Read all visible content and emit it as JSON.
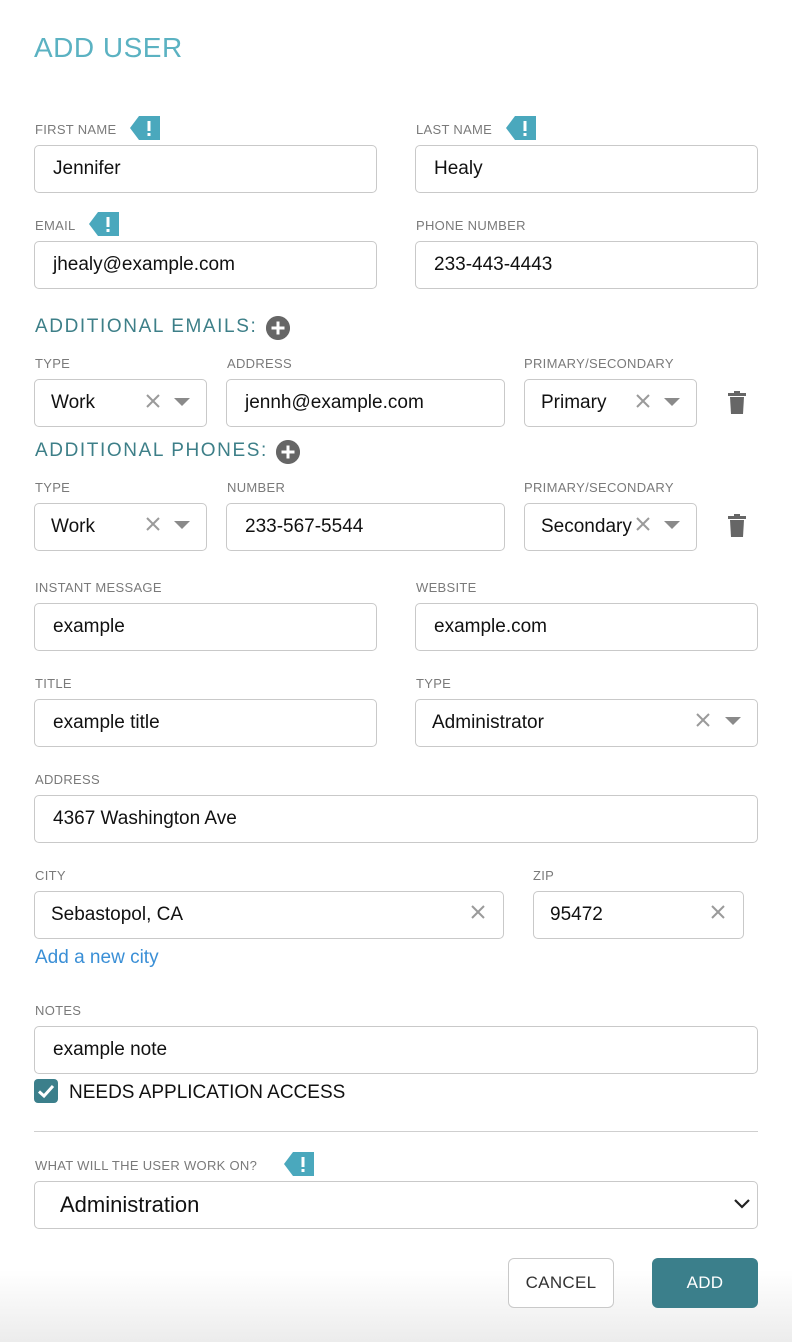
{
  "title": "ADD USER",
  "first_name": {
    "label": "FIRST NAME",
    "value": "Jennifer"
  },
  "last_name": {
    "label": "LAST NAME",
    "value": "Healy"
  },
  "email": {
    "label": "EMAIL",
    "value": "jhealy@example.com"
  },
  "phone": {
    "label": "PHONE NUMBER",
    "value": "233-443-4443"
  },
  "additional_emails": {
    "heading": "ADDITIONAL EMAILS:",
    "col_type": "TYPE",
    "col_address": "ADDRESS",
    "col_primary": "PRIMARY/SECONDARY",
    "rows": [
      {
        "type": "Work",
        "address": "jennh@example.com",
        "primary": "Primary"
      }
    ]
  },
  "additional_phones": {
    "heading": "ADDITIONAL PHONES:",
    "col_type": "TYPE",
    "col_number": "NUMBER",
    "col_primary": "PRIMARY/SECONDARY",
    "rows": [
      {
        "type": "Work",
        "number": "233-567-5544",
        "primary": "Secondary"
      }
    ]
  },
  "instant_message": {
    "label": "INSTANT MESSAGE",
    "value": "example"
  },
  "website": {
    "label": "WEBSITE",
    "value": "example.com"
  },
  "job_title": {
    "label": "TITLE",
    "value": "example title"
  },
  "user_type": {
    "label": "TYPE",
    "value": "Administrator"
  },
  "address": {
    "label": "ADDRESS",
    "value": "4367 Washington Ave"
  },
  "city": {
    "label": "CITY",
    "value": "Sebastopol, CA"
  },
  "zip": {
    "label": "ZIP",
    "value": "95472"
  },
  "add_city_link": "Add a new city",
  "notes": {
    "label": "NOTES",
    "value": "example note"
  },
  "app_access": {
    "label": "NEEDS APPLICATION ACCESS",
    "checked": true
  },
  "work_on": {
    "label": "WHAT WILL THE USER WORK ON?",
    "value": "Administration"
  },
  "buttons": {
    "cancel": "CANCEL",
    "add": "ADD"
  },
  "icons": {
    "required": "required-flag-icon",
    "clear": "clear-x-icon",
    "dropdown": "caret-down-icon",
    "add": "plus-circle-icon",
    "delete": "trash-icon",
    "checkbox": "checkmark-icon"
  },
  "colors": {
    "title": "#5bb2c2",
    "section": "#3d7f88",
    "flag": "#4aa8bd",
    "primary_button": "#3b7f8b",
    "link": "#3a8fd6"
  }
}
